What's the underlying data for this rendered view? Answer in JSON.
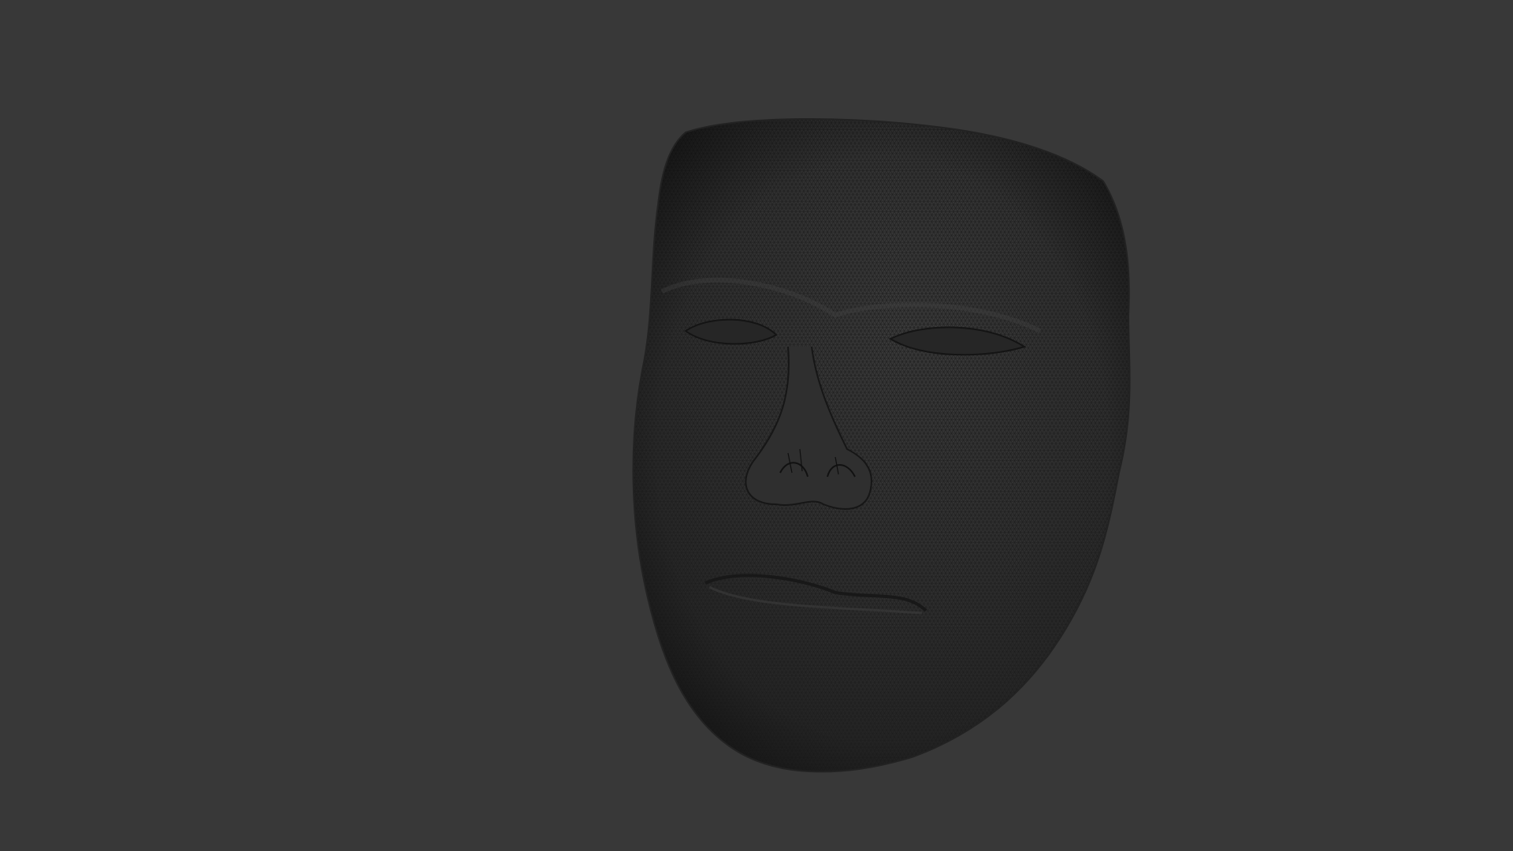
{
  "viewport": {
    "background_color": "#383838",
    "model": {
      "subject": "face-mesh",
      "display_mode": "wireframe-on-shaded",
      "base_color": "#2d2d2d",
      "wire_color": "#1a1a1a"
    }
  }
}
